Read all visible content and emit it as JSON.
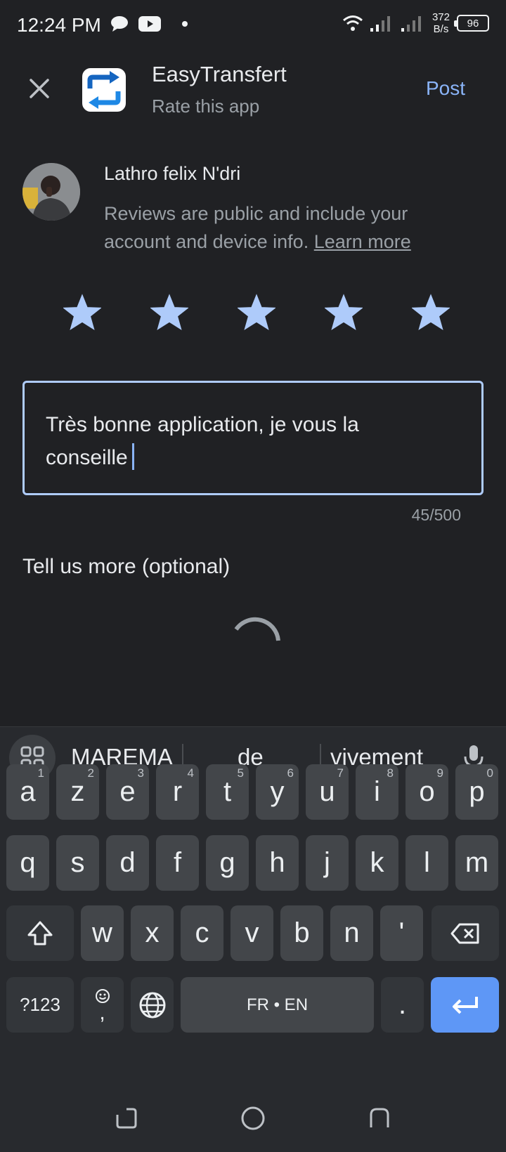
{
  "status_bar": {
    "time": "12:24 PM",
    "speed_top": "372",
    "speed_bottom": "B/s",
    "battery": "96",
    "icons": [
      "chat-bubble-icon",
      "youtube-icon",
      "dot-icon",
      "wifi-icon",
      "signal-icon",
      "signal-icon"
    ]
  },
  "header": {
    "app_name": "EasyTransfert",
    "subtitle": "Rate this app",
    "post_label": "Post"
  },
  "user": {
    "name": "Lathro felix N'dri",
    "disclaimer": "Reviews are public and include your account and device info.",
    "learn_more": "Learn more"
  },
  "rating": {
    "stars": 5,
    "max": 5,
    "color": "#aecbfa"
  },
  "review": {
    "text": "Très bonne application, je vous la conseille",
    "counter": "45/500"
  },
  "tell_more": "Tell us more (optional)",
  "keyboard": {
    "suggestions": [
      "MAREMA",
      "de",
      "vivement"
    ],
    "row1": [
      {
        "k": "a",
        "h": "1"
      },
      {
        "k": "z",
        "h": "2"
      },
      {
        "k": "e",
        "h": "3"
      },
      {
        "k": "r",
        "h": "4"
      },
      {
        "k": "t",
        "h": "5"
      },
      {
        "k": "y",
        "h": "6"
      },
      {
        "k": "u",
        "h": "7"
      },
      {
        "k": "i",
        "h": "8"
      },
      {
        "k": "o",
        "h": "9"
      },
      {
        "k": "p",
        "h": "0"
      }
    ],
    "row2": [
      "q",
      "s",
      "d",
      "f",
      "g",
      "h",
      "j",
      "k",
      "l",
      "m"
    ],
    "row3": [
      "w",
      "x",
      "c",
      "v",
      "b",
      "n",
      "'"
    ],
    "symbols_label": "?123",
    "comma_label": ",",
    "space_label": "FR • EN",
    "period_label": ".",
    "accent_color": "#5e97f6"
  }
}
